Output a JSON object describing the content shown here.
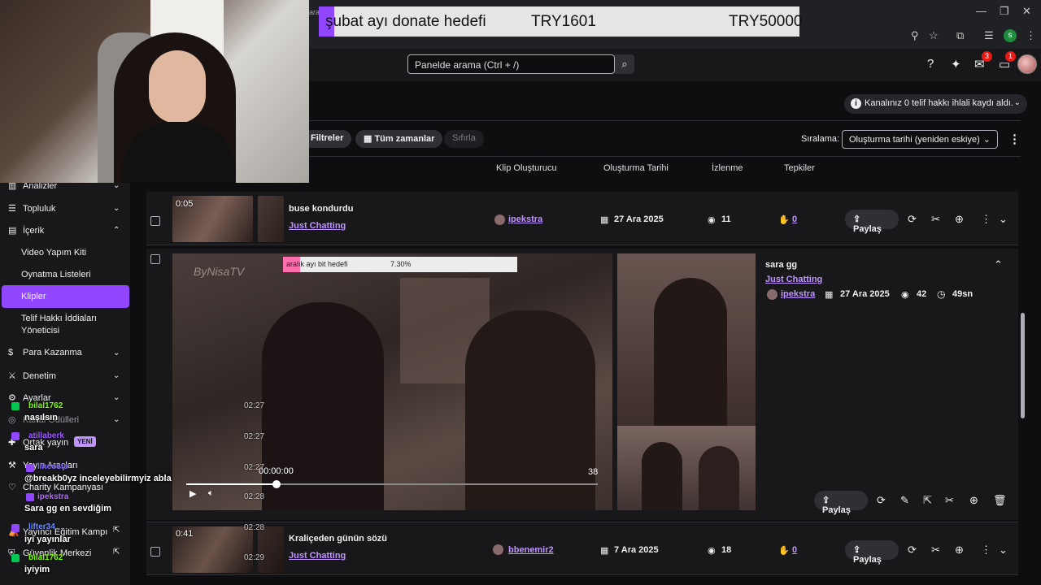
{
  "donation_goal": {
    "title": "şubat ayı donate hedefi",
    "current": "TRY1601",
    "target": "TRY50000",
    "progress_fraction": 0.032
  },
  "browser": {
    "profile_initial": "s",
    "tab_fragment": "ara..."
  },
  "header": {
    "search_placeholder": "Panelde arama (Ctrl + /)",
    "inbox_badge": "3",
    "notifications_badge": "1"
  },
  "page": {
    "title_fragment": "er",
    "copyright_notice": "Kanalınız 0 telif hakkı ihlali kaydı aldı."
  },
  "filters": {
    "filters_label": "Filtreler",
    "time_label": "Tüm zamanlar",
    "reset_label": "Sıfırla",
    "sort_label": "Sıralama:",
    "sort_value": "Oluşturma tarihi (yeniden eskiye)"
  },
  "columns": {
    "creator": "Klip Oluşturucu",
    "created": "Oluşturma Tarihi",
    "views": "İzlenme",
    "reactions": "Tepkiler"
  },
  "clips": [
    {
      "duration": "0:05",
      "title": "buse kondurdu",
      "category": "Just Chatting",
      "creator": "ipekstra",
      "date": "27 Ara 2025",
      "views": "11",
      "likes": "0",
      "share": "Paylaş"
    },
    {
      "title": "sara gg",
      "category": "Just Chatting",
      "creator": "ipekstra",
      "date": "27 Ara 2025",
      "views": "42",
      "length": "49sn",
      "share": "Paylaş",
      "player": {
        "current_time": "00:00:00",
        "end_time": "38",
        "progress_fraction": 0.22,
        "watermark": "ByNisaTV",
        "goal_title": "aralık ayı bit hedefi",
        "goal_percent": "7.30%",
        "goal_fraction": 0.073
      }
    },
    {
      "duration": "0:41",
      "title": "Kraliçeden günün sözü",
      "category": "Just Chatting",
      "creator": "bbenemir2",
      "date": "7 Ara 2025",
      "views": "18",
      "likes": "0",
      "share": "Paylaş"
    }
  ],
  "nav": {
    "analytics": "Analizler",
    "community": "Topluluk",
    "content": "İçerik",
    "video_kit": "Video Yapım Kiti",
    "playlists": "Oynatma Listeleri",
    "clips": "Klipler",
    "copyright_claims": "Telif Hakkı İddiaları Yöneticisi",
    "monetization": "Para Kazanma",
    "moderation": "Denetim",
    "settings": "Ayarlar",
    "rewards": "Kanal Ödülleri",
    "affiliate": "Ortak yayın",
    "new_badge": "YENİ",
    "stream_tools": "Yayın Araçları",
    "charity": "Charity Kampanyası",
    "creator_camp": "Yayıncı Eğitim Kampı",
    "safety_center": "Güvenlik Merkezi"
  },
  "chat": {
    "messages": [
      {
        "user": "bilal1762",
        "text": "naşılsın",
        "color": "#7fff00",
        "ts": "02:27"
      },
      {
        "user": "atillaberk",
        "text": "sara",
        "color": "#9b5cff",
        "ts": "02:27"
      },
      {
        "user": "lincoste",
        "text": "@breakb0yz inceleyebilirmyiz abla",
        "color": "#7f6bff",
        "ts": "02:27"
      },
      {
        "user": "ipekstra",
        "text": "Sara gg en sevdiğim",
        "color": "#b36bff",
        "ts": "02:28"
      },
      {
        "user": "lifter34",
        "text": "iyi yayınlar",
        "color": "#6b8cff",
        "ts": "02:28"
      },
      {
        "user": "bilal1762",
        "text": "iyiyim",
        "color": "#7fff00",
        "ts": "02:29"
      }
    ]
  },
  "colors": {
    "accent": "#9147ff",
    "link": "#bf94ff",
    "background": "#0e0e10",
    "panel": "#18181b"
  }
}
